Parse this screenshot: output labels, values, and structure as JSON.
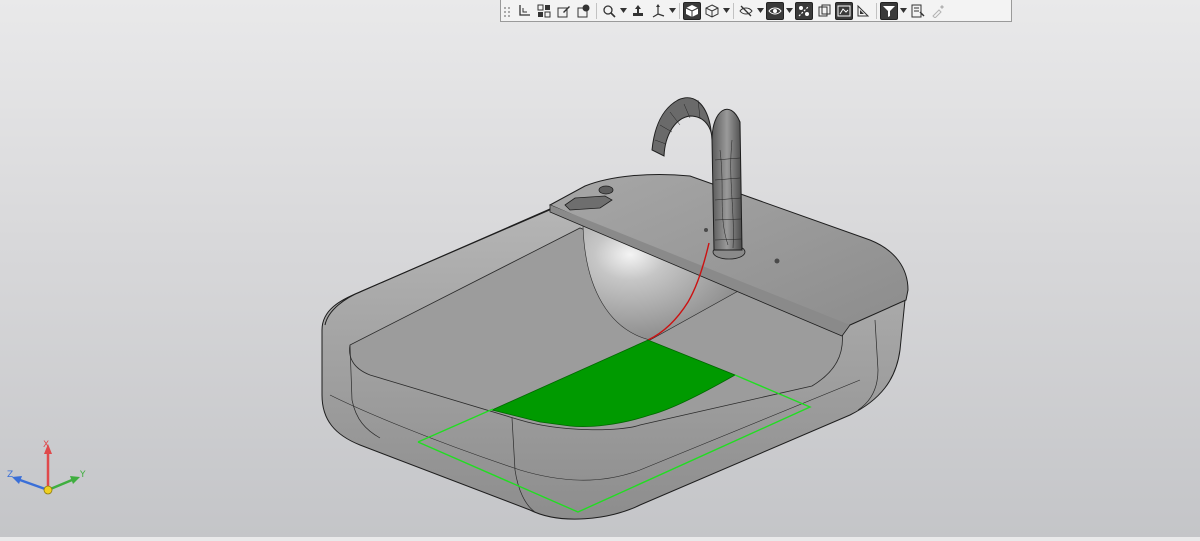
{
  "toolbar": {
    "buttons": [
      {
        "name": "grip-handle",
        "icon": "grip-icon"
      },
      {
        "name": "local-cs-button",
        "icon": "coordinate-system-icon"
      },
      {
        "name": "components-button",
        "icon": "components-icon"
      },
      {
        "name": "edit-button",
        "icon": "edit-icon"
      },
      {
        "name": "view-orientation-button",
        "icon": "orientation-icon"
      },
      {
        "name": "zoom-button",
        "icon": "magnifier-icon",
        "dropdown": true
      },
      {
        "name": "pan-button",
        "icon": "pan-icon"
      },
      {
        "name": "rotate-button",
        "icon": "rotate-axes-icon",
        "dropdown": true
      },
      {
        "name": "shaded-with-edges-button",
        "icon": "shaded-cube-icon",
        "active": true
      },
      {
        "name": "wireframe-button",
        "icon": "wireframe-cube-icon",
        "dropdown": true
      },
      {
        "name": "hidden-lines-button",
        "icon": "eye-slash-icon",
        "dropdown": true
      },
      {
        "name": "visibility-button",
        "icon": "eye-icon",
        "active": true,
        "dropdown": true
      },
      {
        "name": "section-button",
        "icon": "section-icon",
        "active": true
      },
      {
        "name": "perspective-button",
        "icon": "perspective-icon"
      },
      {
        "name": "display-mode-button",
        "icon": "display-mode-icon",
        "active": true
      },
      {
        "name": "layers-button",
        "icon": "layers-icon"
      },
      {
        "name": "filter-button",
        "icon": "filter-icon",
        "active": true,
        "dropdown": true
      },
      {
        "name": "properties-button",
        "icon": "properties-icon"
      },
      {
        "name": "eyedropper-button",
        "icon": "eyedropper-icon",
        "disabled": true
      }
    ]
  },
  "triad": {
    "x_label": "X",
    "y_label": "Y",
    "z_label": "Z",
    "colors": {
      "x": "#e0494b",
      "y": "#3fae3f",
      "z": "#3a6fd8",
      "origin": "#f0d020"
    }
  },
  "model": {
    "colors": {
      "body": "#a9a9a9",
      "edge": "#1e1e1e",
      "selected_face": "#009a00",
      "sketch_plane": "#22dd22",
      "sketch_curve": "#cc1111"
    }
  }
}
